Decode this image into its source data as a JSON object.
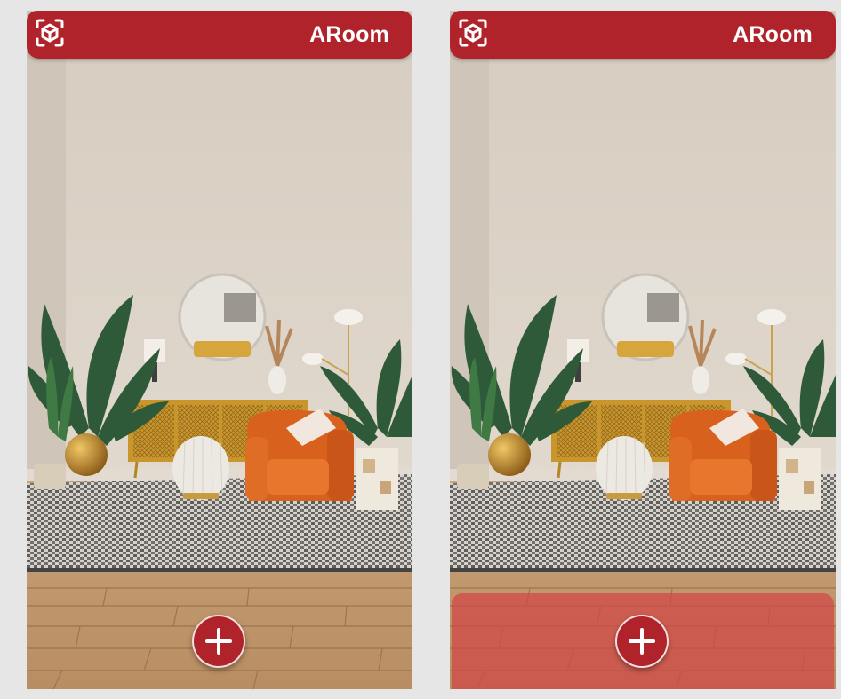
{
  "screens": [
    {
      "id": "left",
      "app_title": "ARoom",
      "floor_detected": false,
      "icons": {
        "header": "ar-cube-scan-icon",
        "fab": "plus-icon"
      }
    },
    {
      "id": "right",
      "app_title": "ARoom",
      "floor_detected": true,
      "icons": {
        "header": "ar-cube-scan-icon",
        "fab": "plus-icon"
      }
    }
  ],
  "colors": {
    "brand": "#b0232a",
    "floor_highlight": "#d24646",
    "page_background": "#e6e6e6"
  }
}
